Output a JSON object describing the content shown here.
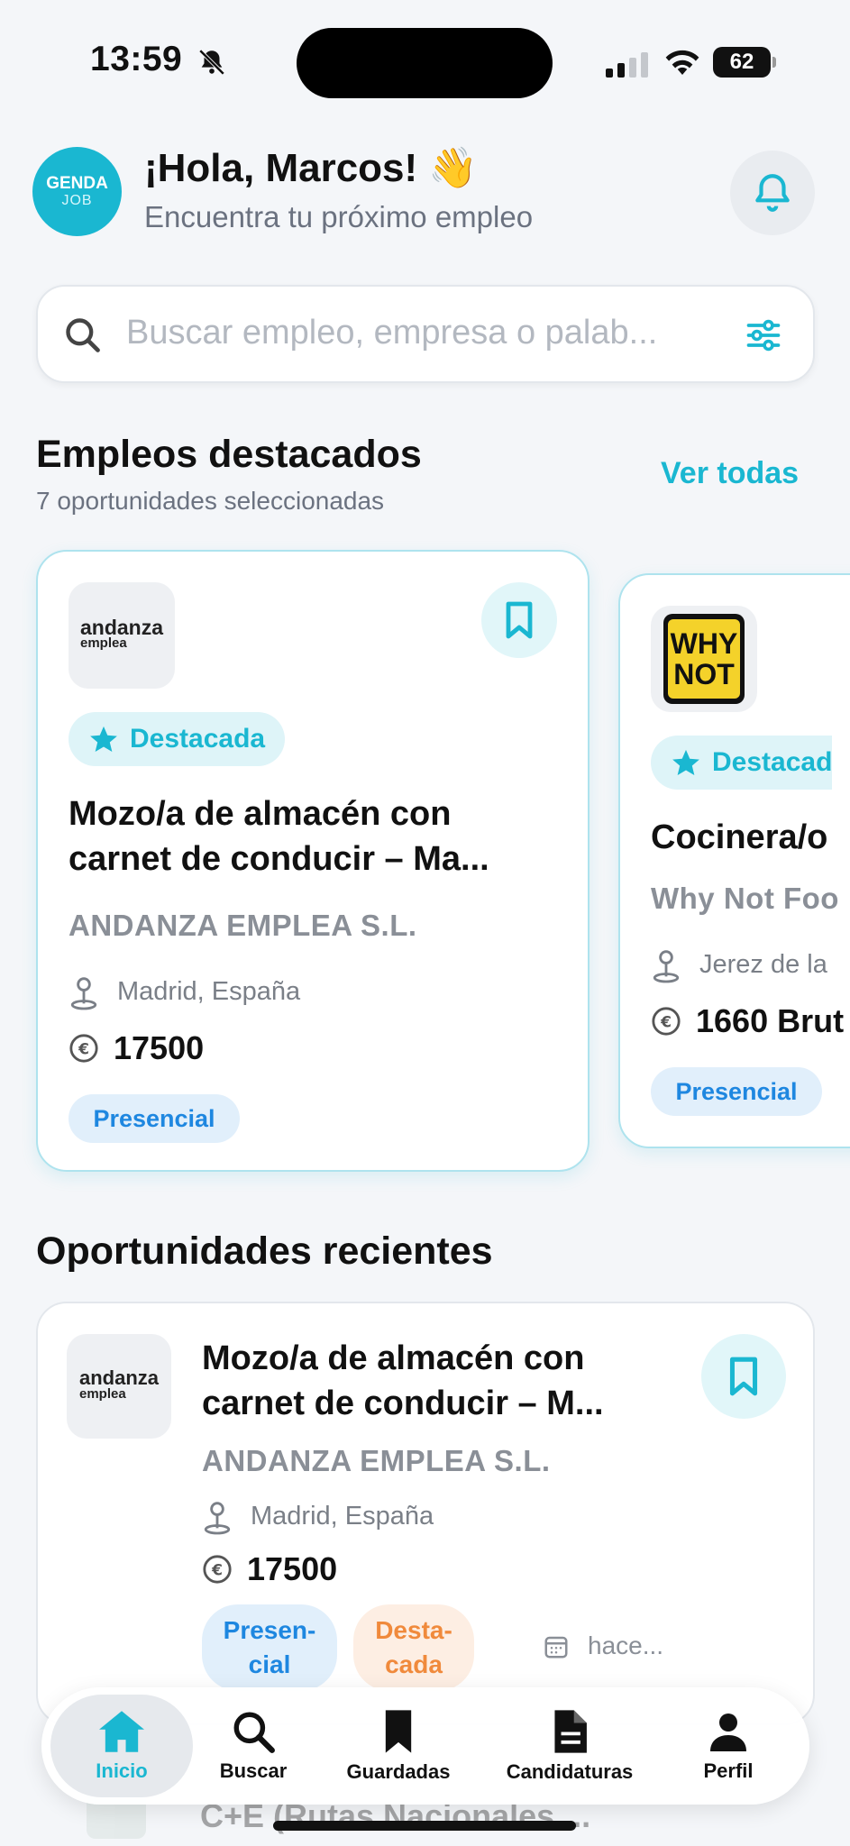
{
  "status_bar": {
    "time": "13:59",
    "battery": "62"
  },
  "header": {
    "logo_top": "GENDA",
    "logo_bottom": "JOB",
    "greeting": "¡Hola, Marcos! 👋",
    "subtitle": "Encuentra tu próximo empleo"
  },
  "search": {
    "placeholder": "Buscar empleo, empresa o palab..."
  },
  "featured": {
    "title": "Empleos destacados",
    "subtitle": "7 oportunidades seleccionadas",
    "see_all": "Ver todas",
    "cards": [
      {
        "logo_text_top": "andanza",
        "logo_text_bottom": "emplea",
        "badge": "Destacada",
        "title_line1": "Mozo/a de almacén con",
        "title_line2": "carnet de conducir – Ma...",
        "company": "ANDANZA EMPLEA S.L.",
        "location": "Madrid, España",
        "salary": "17500",
        "modality": "Presencial"
      },
      {
        "logo_text_top": "WHY",
        "logo_text_bottom": "NOT",
        "badge": "Destacad",
        "title_line1": "Cocinera/o",
        "company": "Why Not Foo",
        "location": "Jerez de la",
        "salary": "1660 Brut",
        "modality": "Presencial"
      }
    ]
  },
  "recent": {
    "title": "Oportunidades recientes",
    "items": [
      {
        "logo_text_top": "andanza",
        "logo_text_bottom": "emplea",
        "title_line1": "Mozo/a de almacén con",
        "title_line2": "carnet de conducir – M...",
        "company": "ANDANZA EMPLEA S.L.",
        "location": "Madrid, España",
        "salary": "17500",
        "tag1_line1": "Presen-",
        "tag1_line2": "cial",
        "tag2_line1": "Desta-",
        "tag2_line2": "cada",
        "date": "hace..."
      }
    ],
    "peek_text": "C+E (Rutas Nacionales ..."
  },
  "tabbar": {
    "home": "Inicio",
    "search": "Buscar",
    "saved": "Guardadas",
    "applications": "Candidaturas",
    "profile": "Perfil"
  },
  "colors": {
    "accent": "#1ab7d1",
    "blue": "#1e87e0",
    "orange": "#f08a3c"
  }
}
